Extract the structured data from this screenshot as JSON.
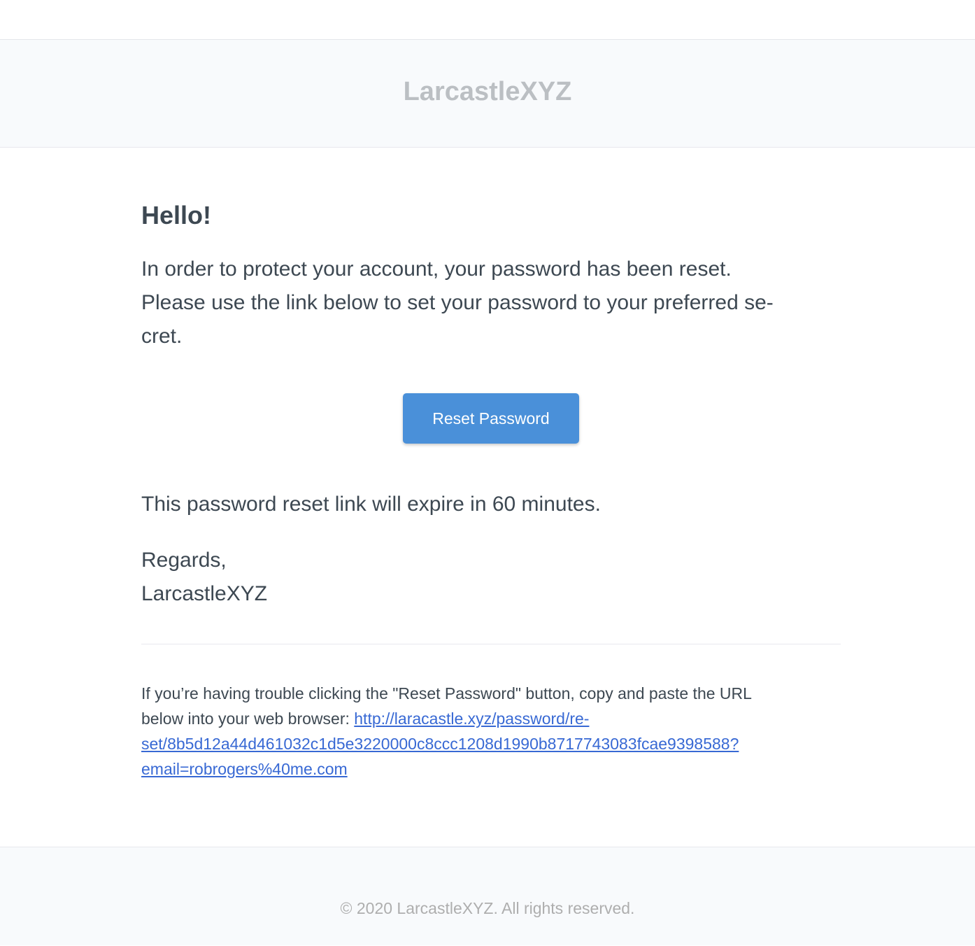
{
  "header": {
    "brand": "LarcastleXYZ"
  },
  "email": {
    "greeting": "Hello!",
    "intro_lines": [
      "In order to protect your account, your password has been reset.",
      "Please use the link below to set your password to your preferred se-",
      "cret."
    ],
    "button_label": "Reset Password",
    "expire_text": "This password reset link will expire in 60 minutes.",
    "regards": "Regards,",
    "signature": "LarcastleXYZ",
    "subcopy": {
      "line1": "If you’re having trouble clicking the \"Reset Password\" button, copy and paste the URL",
      "line2_prefix": "below into your web browser: ",
      "url_lines": [
        "http://laracastle.xyz/password/re-",
        "set/8b5d12a44d461032c1d5e3220000c8ccc1208d1990b8717743083fcae9398588?",
        "email=robrogers%40me.com"
      ]
    }
  },
  "footer": {
    "copyright": "© 2020 LarcastleXYZ. All rights reserved."
  },
  "colors": {
    "button": "#4a90d9",
    "link": "#3869d4",
    "text": "#3d4852",
    "brand": "#bbbfc3",
    "muted": "#aeaeae",
    "panel_bg": "#f8fafc"
  }
}
